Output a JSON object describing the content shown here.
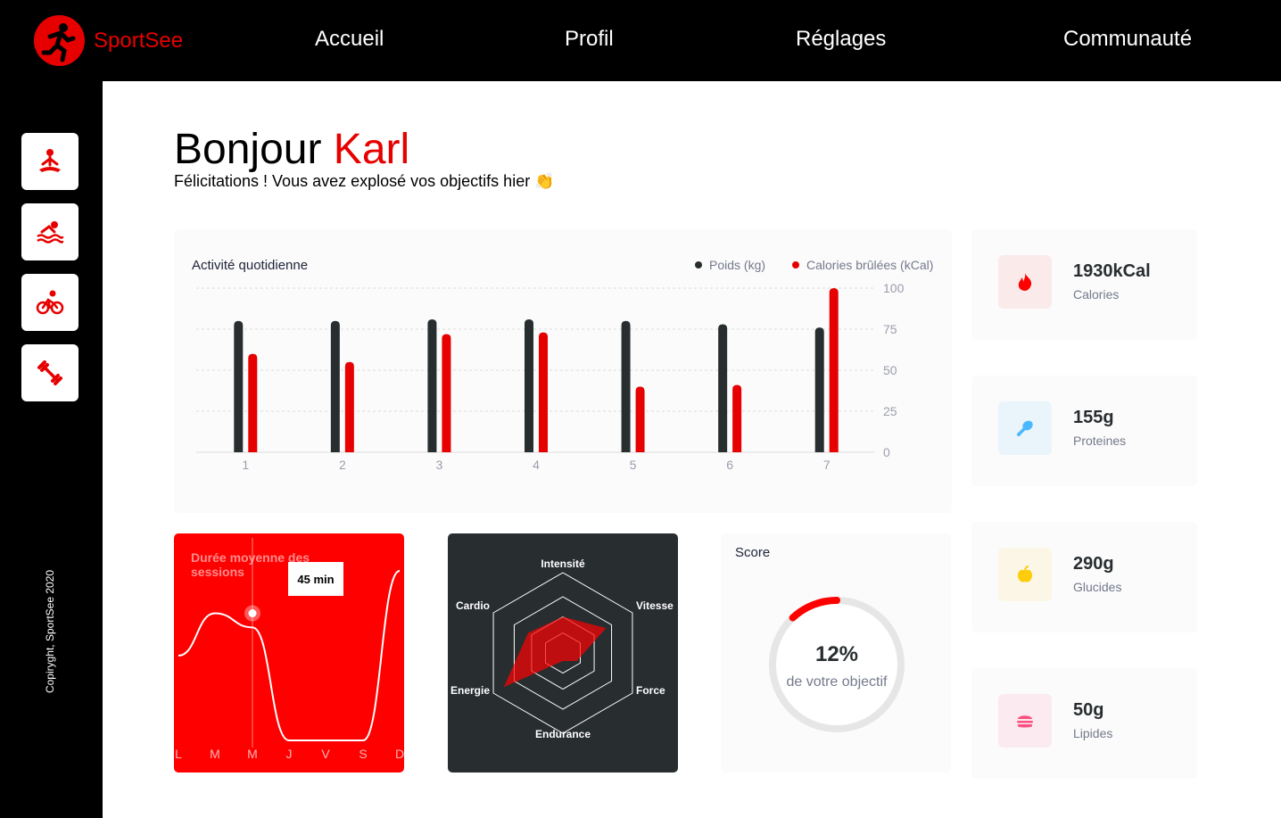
{
  "app": {
    "name": "SportSee"
  },
  "nav": {
    "home": "Accueil",
    "profile": "Profil",
    "settings": "Réglages",
    "community": "Communauté"
  },
  "sidebar": {
    "copyright": "Copiryght, SportSee 2020",
    "items": [
      "yoga-icon",
      "swim-icon",
      "bike-icon",
      "dumbbell-icon"
    ]
  },
  "header": {
    "greeting": "Bonjour",
    "name": "Karl",
    "message": "Félicitations ! Vous avez explosé vos objectifs hier 👏"
  },
  "activity": {
    "title": "Activité quotidienne",
    "legend_weight": "Poids (kg)",
    "legend_calories": "Calories brûlées (kCal)",
    "weight_color": "#282d30",
    "calories_color": "#e60000"
  },
  "duration": {
    "title": "Durée moyenne des sessions",
    "tooltip": "45 min"
  },
  "score": {
    "title": "Score",
    "percent_text": "12%",
    "subtitle": "de votre objectif",
    "value": 0.12
  },
  "keydata": [
    {
      "value": "1930kCal",
      "label": "Calories",
      "icon": "flame-icon",
      "bg": "#fbeaea",
      "color": "#ff0000"
    },
    {
      "value": "155g",
      "label": "Proteines",
      "icon": "chicken-icon",
      "bg": "#e9f4fb",
      "color": "#4ab8ff"
    },
    {
      "value": "290g",
      "label": "Glucides",
      "icon": "apple-icon",
      "bg": "#fbf6e5",
      "color": "#fdcc0c"
    },
    {
      "value": "50g",
      "label": "Lipides",
      "icon": "burger-icon",
      "bg": "#fbeaef",
      "color": "#fd5181"
    }
  ],
  "chart_data": [
    {
      "type": "bar",
      "categories": [
        "1",
        "2",
        "3",
        "4",
        "5",
        "6",
        "7"
      ],
      "series": [
        {
          "name": "Poids (kg)",
          "values": [
            80,
            80,
            81,
            81,
            80,
            78,
            76
          ]
        },
        {
          "name": "Calories brûlées (kCal)",
          "values": [
            60,
            55,
            72,
            73,
            40,
            41,
            100
          ]
        }
      ],
      "yticks": [
        "0",
        "25",
        "50",
        "75",
        "100"
      ],
      "ylim": [
        0,
        100
      ],
      "grid": true,
      "legend": "top-right"
    },
    {
      "type": "line",
      "title": "Durée moyenne des sessions",
      "categories": [
        "L",
        "M",
        "M",
        "J",
        "V",
        "S",
        "D"
      ],
      "values": [
        30,
        45,
        40,
        0,
        0,
        0,
        60
      ]
    },
    {
      "type": "radar",
      "categories": [
        "Intensité",
        "Vitesse",
        "Force",
        "Endurance",
        "Energie",
        "Cardio"
      ],
      "values": [
        0.45,
        0.62,
        0.2,
        0.1,
        0.85,
        0.5
      ]
    }
  ]
}
